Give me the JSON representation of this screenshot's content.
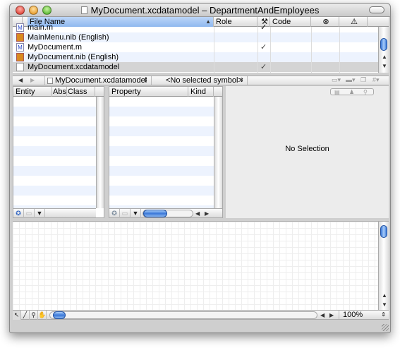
{
  "window": {
    "title": "MyDocument.xcdatamodel – DepartmentAndEmployees"
  },
  "file_table": {
    "columns": {
      "file_name": "File Name",
      "role": "Role",
      "code": "Code"
    },
    "rows": [
      {
        "name": "main.m",
        "icon": "m-file-icon",
        "checked": "✓"
      },
      {
        "name": "MainMenu.nib (English)",
        "icon": "nib-icon",
        "checked": ""
      },
      {
        "name": "MyDocument.m",
        "icon": "m-file-icon",
        "checked": "✓"
      },
      {
        "name": "MyDocument.nib (English)",
        "icon": "nib-icon",
        "checked": ""
      },
      {
        "name": "MyDocument.xcdatamodel",
        "icon": "datamodel-icon",
        "checked": "✓"
      }
    ]
  },
  "nav_bar": {
    "file_popup": "MyDocument.xcdatamodel",
    "symbol_popup": "<No selected symbol>"
  },
  "entity_table": {
    "columns": {
      "entity": "Entity",
      "abs": "Abs",
      "class": "Class"
    }
  },
  "property_table": {
    "columns": {
      "property": "Property",
      "kind": "Kind"
    }
  },
  "inspector": {
    "empty_text": "No Selection"
  },
  "diagram": {
    "zoom": "100%"
  },
  "colors": {
    "selection": "#d4d4d4",
    "stripe": "#edf3fe",
    "header_selected": "#8fb8ef",
    "accent": "#3a78d8"
  }
}
